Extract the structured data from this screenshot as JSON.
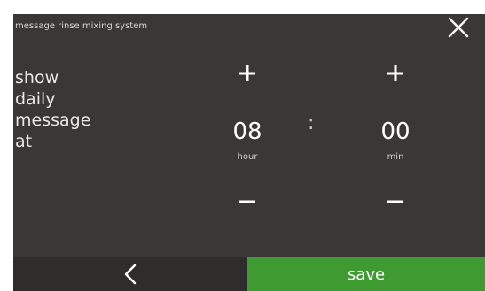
{
  "dialog": {
    "title": "message rinse mixing system",
    "prompt_lines": [
      "show",
      "daily",
      "message",
      "at"
    ]
  },
  "time": {
    "hour": {
      "value": "08",
      "unit": "hour"
    },
    "separator": ":",
    "minute": {
      "value": "00",
      "unit": "min"
    }
  },
  "footer": {
    "back_icon": "chevron-left-icon",
    "save_label": "save"
  },
  "colors": {
    "panel_bg": "#3a3836",
    "footer_left_bg": "#2f2d2b",
    "save_bg": "#3f9a32"
  }
}
